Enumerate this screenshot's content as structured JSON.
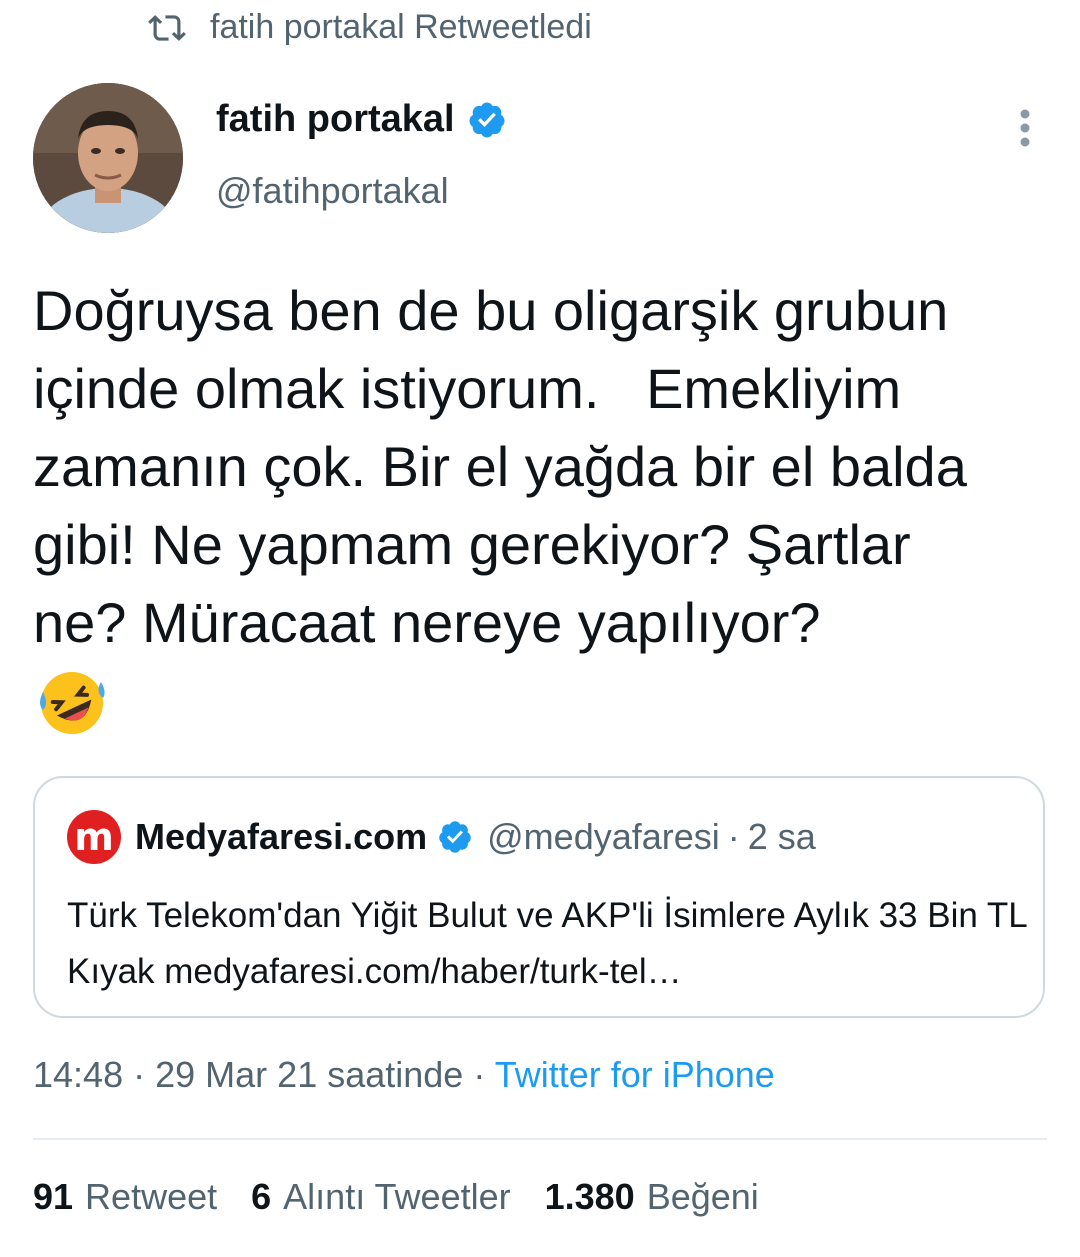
{
  "retweet_header": {
    "icon": "retweet-icon",
    "label": "fatih portakal Retweetledi"
  },
  "author": {
    "avatar": "profile-photo",
    "name": "fatih portakal",
    "verified": true,
    "handle": "@fatihportakal"
  },
  "tweet": {
    "text": "Doğruysa ben de bu oligarşik grubun\niçinde olmak istiyorum.   Emekliyim\nzamanın çok. Bir el yağda bir el balda\ngibi! Ne yapmam gerekiyor? Şartlar\nne? Müracaat nereye yapılıyor?",
    "emoji": "rolling-on-floor-laughing"
  },
  "quoted_tweet": {
    "logo_letter": "m",
    "name": "Medyafaresi.com",
    "verified": true,
    "handle": "@medyafaresi",
    "separator": "·",
    "time": "2 sa",
    "text": "Türk Telekom'dan Yiğit Bulut ve AKP'li İsimlere Aylık 33 Bin TL Kıyak medyafaresi.com/haber/turk-tel…"
  },
  "meta": {
    "time": "14:48",
    "separator": "·",
    "date": "29 Mar 21 saatinde",
    "separator2": "·",
    "source": "Twitter for iPhone"
  },
  "stats": {
    "retweets_count": "91",
    "retweets_label": "Retweet",
    "quotes_count": "6",
    "quotes_label": "Alıntı Tweetler",
    "likes_count": "1.380",
    "likes_label": "Beğeni"
  },
  "colors": {
    "accent": "#1d9bf0",
    "secondary_text": "#536471",
    "primary_text": "#0f1419",
    "logo_red": "#e02020"
  }
}
